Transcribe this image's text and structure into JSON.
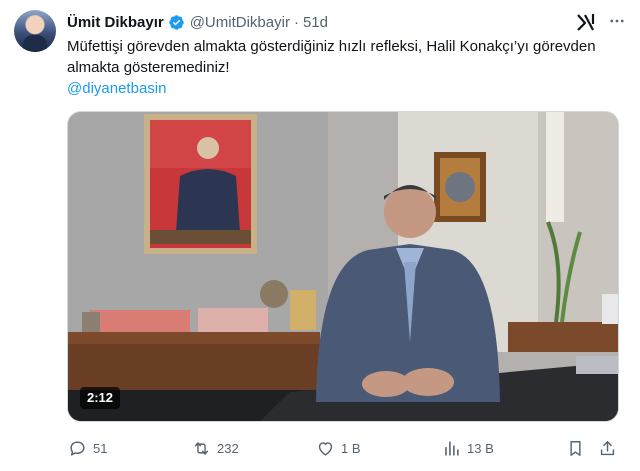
{
  "tweet": {
    "author_name": "Ümit Dikbayır",
    "handle": "@UmitDikbayir",
    "separator": "·",
    "age": "51d",
    "text": "Müfettişi görevden almakta gösterdiğiniz hızlı refleksi, Halil Konakçı’yı görevden almakta gösteremediniz!",
    "mention": "@diyanetbasin",
    "media": {
      "type": "video",
      "duration": "2:12"
    }
  },
  "actions": {
    "replies": "51",
    "reposts": "232",
    "likes": "1 B",
    "views": "13 B"
  },
  "icons": {
    "verified": "verified-badge-icon",
    "grok": "grok-icon",
    "more": "more-icon",
    "reply": "reply-icon",
    "repost": "repost-icon",
    "like": "like-icon",
    "views": "views-icon",
    "bookmark": "bookmark-icon",
    "share": "share-icon"
  },
  "colors": {
    "text": "#0f1419",
    "secondary": "#536471",
    "link": "#1d9bf0",
    "verified": "#1d9bf0"
  }
}
